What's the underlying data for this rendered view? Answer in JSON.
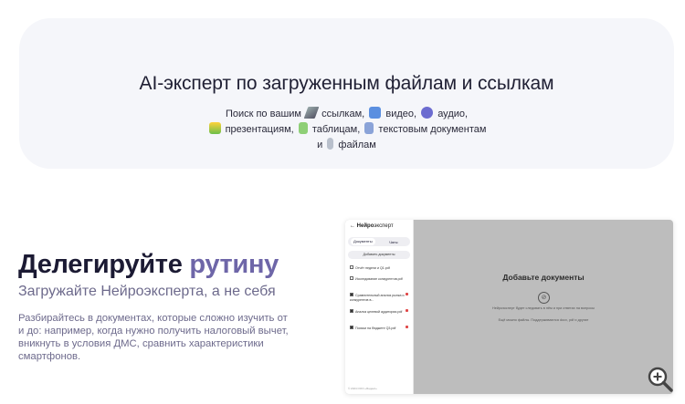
{
  "hero": {
    "title": "AI-эксперт по загруженным файлам и ссылкам",
    "line1_a": "Поиск по вашим",
    "line1_b": "ссылкам,",
    "line1_c": "видео,",
    "line1_d": "аудио,",
    "line2_a": "презентациям,",
    "line2_b": "таблицам,",
    "line2_c": "текстовым документам",
    "line3_a": "и",
    "line3_b": "файлам"
  },
  "lead": {
    "title_main": "Делегируйте",
    "title_accent": "рутину",
    "subtitle": "Загружайте Нейроэксперта, а не себя",
    "description": "Разбирайтесь в документах, которые сложно изучить от и до: например, когда нужно получить налоговый вычет, вникнуть в условия ДМС, сравнить характеристики смартфонов."
  },
  "app": {
    "brand_bold": "Нейро",
    "brand_rest": "эксперт",
    "tab_docs": "Документы",
    "tab_chats": "Чаты",
    "add_button": "Добавить документы",
    "docs": [
      {
        "title": "Отчёт недели и Q1.pdf",
        "checked": false
      },
      {
        "title": "Исследование конкурентов.pdf",
        "checked": false
      },
      {
        "title": "Сравнительный анализ рынка и конкурентов в...",
        "checked": true
      },
      {
        "title": "Анализ целевой аудитории.pdf",
        "checked": true
      },
      {
        "title": "Поиски на бюджете Q3.pdf",
        "checked": true
      }
    ],
    "footer": "© 2024 ООО «Яндекс»",
    "main_title": "Добавьте документы",
    "main_icon": "⊘",
    "main_sub": "Нейроэксперт будет следовать в нём и при ответах на вопросы",
    "main_formats": "Ещё можно файлы. Поддерживаются docx, pdf и другие"
  },
  "icons": {
    "link": "link-emoji",
    "video": "video-emoji",
    "audio": "audio-emoji",
    "presentation": "presentation-emoji",
    "table": "table-emoji",
    "document": "document-emoji",
    "file": "paperclip-emoji",
    "zoom": "zoom-in-icon"
  },
  "colors": {
    "hero_bg": "#f5f6fa",
    "accent": "#6e66a8",
    "sub_text": "#6d6a8c",
    "app_canvas": "#bdbdbd"
  }
}
